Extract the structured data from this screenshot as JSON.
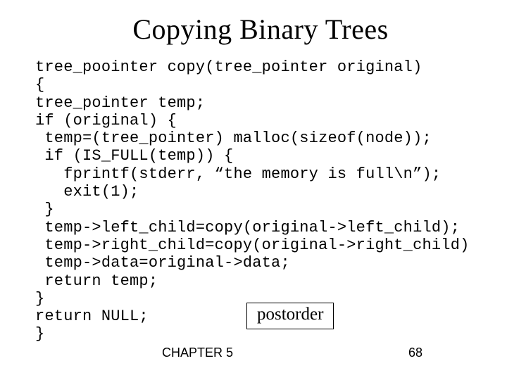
{
  "title": "Copying Binary Trees",
  "code": "tree_poointer copy(tree_pointer original)\n{\ntree_pointer temp;\nif (original) {\n temp=(tree_pointer) malloc(sizeof(node));\n if (IS_FULL(temp)) {\n   fprintf(stderr, “the memory is full\\n”);\n   exit(1);\n }\n temp->left_child=copy(original->left_child);\n temp->right_child=copy(original->right_child)\n temp->data=original->data;\n return temp;\n}\nreturn NULL;\n}",
  "annotation": "postorder",
  "footer": {
    "chapter": "CHAPTER 5",
    "page": "68"
  }
}
